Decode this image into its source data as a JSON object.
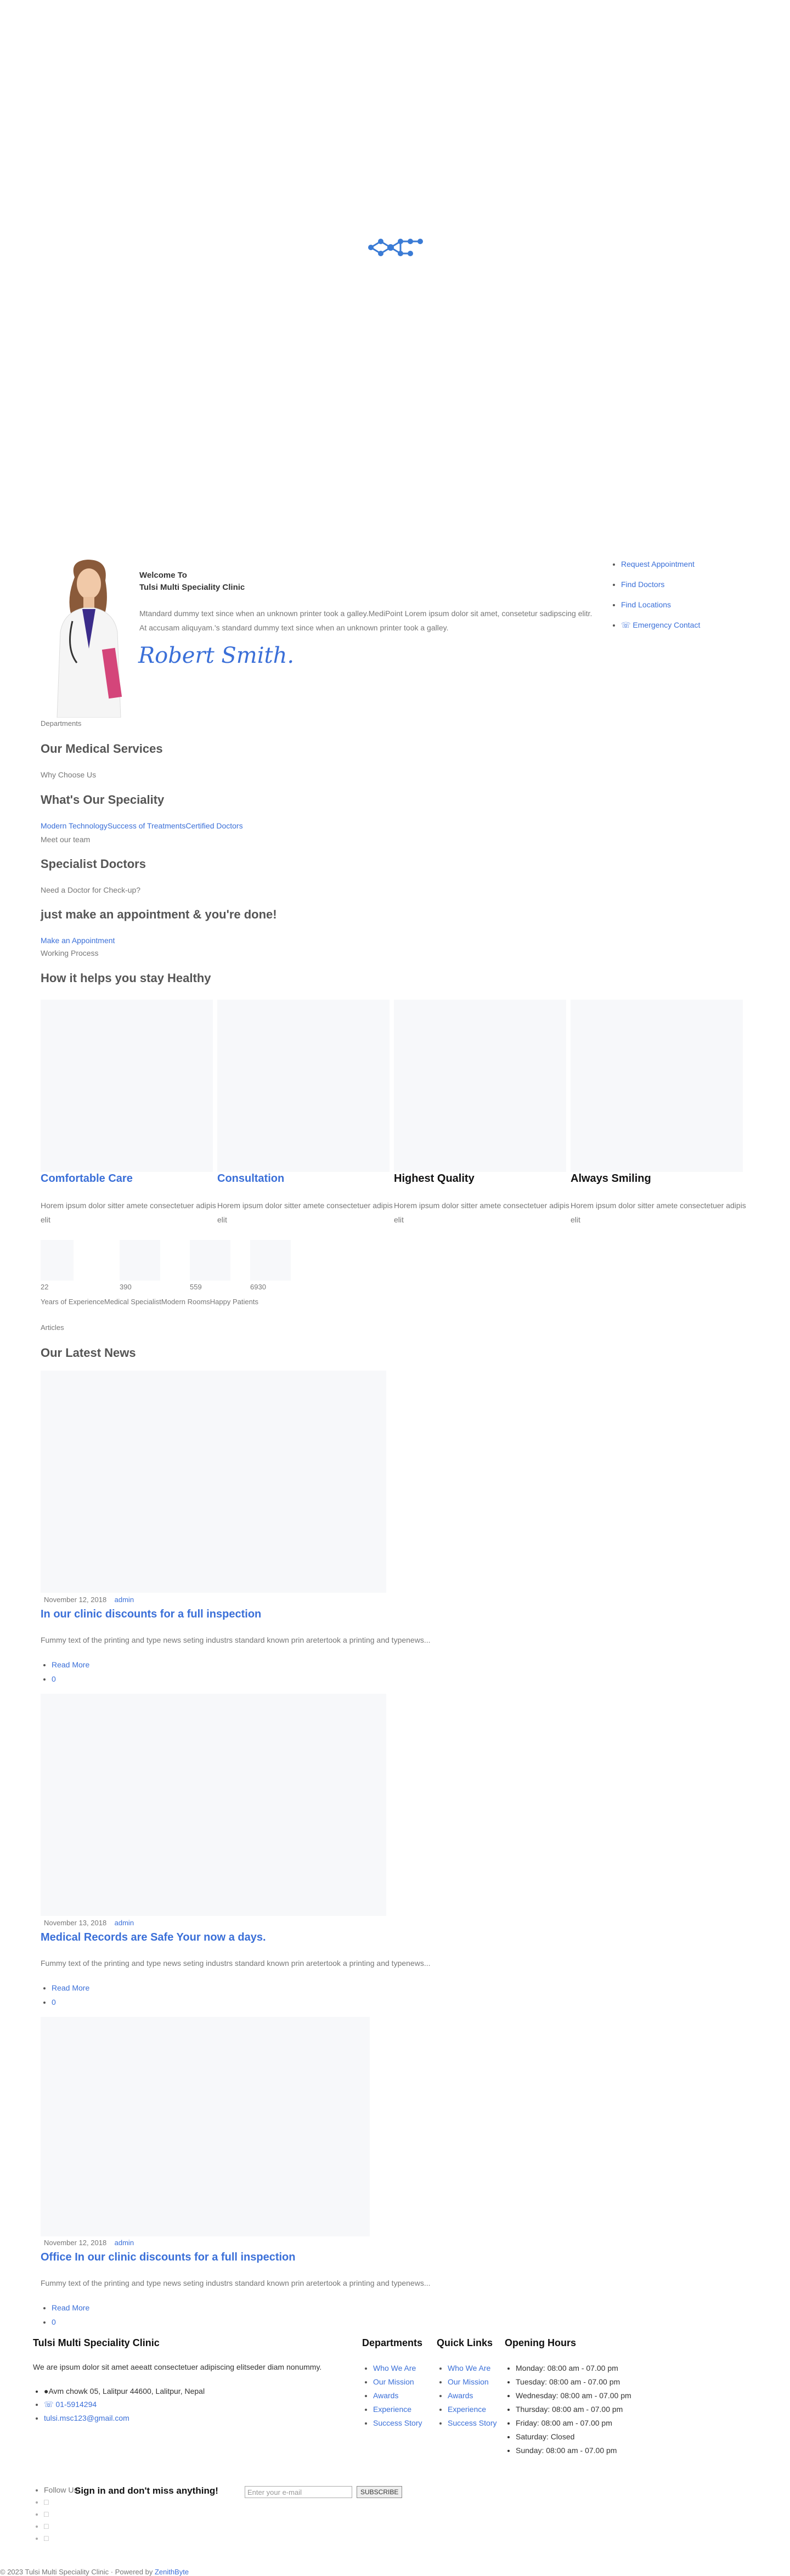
{
  "preloader": {
    "logo_icon": "molecule-logo-icon",
    "color": "#3a7bd5"
  },
  "hero": {
    "welcome": "Welcome To",
    "clinic_name": "Tulsi Multi Speciality Clinic",
    "intro": "Mtandard dummy text since when an unknown printer took a galley.MediPoint Lorem ipsum dolor sit amet, consetetur sadipscing elitr. At accusam aliquyam.'s standard dummy text since when an unknown printer took a galley.",
    "signature": "Robert Smith.",
    "quick_links": [
      "Request Appointment",
      "Find Doctors",
      "Find Locations",
      "Emergency Contact"
    ]
  },
  "sections": {
    "departments_label": "Departments",
    "medical_services_title": "Our Medical Services",
    "why_choose_label": "Why Choose Us",
    "speciality_title": "What's Our Speciality",
    "speciality_links": [
      "Modern Technology",
      "Success of Treatments",
      "Certified Doctors"
    ],
    "team_label": "Meet our team",
    "doctors_title": "Specialist Doctors",
    "checkup_label": "Need a Doctor for Check-up?",
    "appointment_title": "just make an appointment & you're done!",
    "appointment_link": "Make an Appointment",
    "process_label": "Working Process",
    "healthy_title": "How it helps you stay Healthy"
  },
  "services": [
    {
      "title": "Comfortable Care",
      "text": "Horem ipsum dolor sitter amete consectetuer adipis elit",
      "linked": true
    },
    {
      "title": "Consultation",
      "text": "Horem ipsum dolor sitter amete consectetuer adipis elit",
      "linked": true
    },
    {
      "title": "Highest Quality",
      "text": "Horem ipsum dolor sitter amete consectetuer adipis elit",
      "linked": false
    },
    {
      "title": "Always Smiling",
      "text": "Horem ipsum dolor sitter amete consectetuer adipis elit",
      "linked": false
    }
  ],
  "stats": [
    {
      "value": "22",
      "label": "Years of Experience"
    },
    {
      "value": "390",
      "label": "Medical Specialist"
    },
    {
      "value": "559",
      "label": "Modern Rooms"
    },
    {
      "value": "6930",
      "label": "Happy Patients"
    }
  ],
  "news": {
    "label": "Articles",
    "title": "Our Latest News",
    "posts": [
      {
        "date": "November 12, 2018",
        "author": "admin",
        "title": "In our clinic discounts for a full inspection",
        "excerpt": "Fummy text of the printing and type news seting industrs standard known prin aretertook a printing and typenews...",
        "read_more": "Read More",
        "comments": "0"
      },
      {
        "date": "November 13, 2018",
        "author": "admin",
        "title": "Medical Records are Safe Your now a days.",
        "excerpt": "Fummy text of the printing and type news seting industrs standard known prin aretertook a printing and typenews...",
        "read_more": "Read More",
        "comments": "0"
      },
      {
        "date": "November 12, 2018",
        "author": "admin",
        "title": "Office In our clinic discounts for a full inspection",
        "excerpt": "Fummy text of the printing and type news seting industrs standard known prin aretertook a printing and typenews...",
        "read_more": "Read More",
        "comments": "0"
      }
    ]
  },
  "footer": {
    "about_title": "Tulsi Multi Speciality Clinic",
    "about_text": "We are ipsum dolor sit amet aeeatt consectetuer adipiscing elitseder diam nonummy.",
    "address": "Avm chowk 05, Lalitpur 44600, Lalitpur, Nepal",
    "phone": "01-5914294",
    "email": "tulsi.msc123@gmail.com",
    "departments_title": "Departments",
    "departments_links": [
      "Who We Are",
      "Our Mission",
      "Awards",
      "Experience",
      "Success Story"
    ],
    "quick_links_title": "Quick Links",
    "quick_links": [
      "Who We Are",
      "Our Mission",
      "Awards",
      "Experience",
      "Success Story"
    ],
    "hours_title": "Opening Hours",
    "hours": [
      "Monday: 08:00 am - 07.00 pm",
      "Tuesday: 08:00 am - 07.00 pm",
      "Wednesday: 08:00 am - 07.00 pm",
      "Thursday: 08:00 am - 07.00 pm",
      "Friday: 08:00 am - 07.00 pm",
      "Saturday: Closed",
      "Sunday: 08:00 am - 07.00 pm"
    ],
    "follow_label": "Follow Us:",
    "newsletter_title": "Sign in and don't miss anything!",
    "email_placeholder": "Enter your e-mail",
    "subscribe_label": "SUBSCRIBE",
    "copyright": "© 2023 Tulsi Multi Speciality Clinic · Powered by",
    "powered_by": "ZenithByte"
  }
}
